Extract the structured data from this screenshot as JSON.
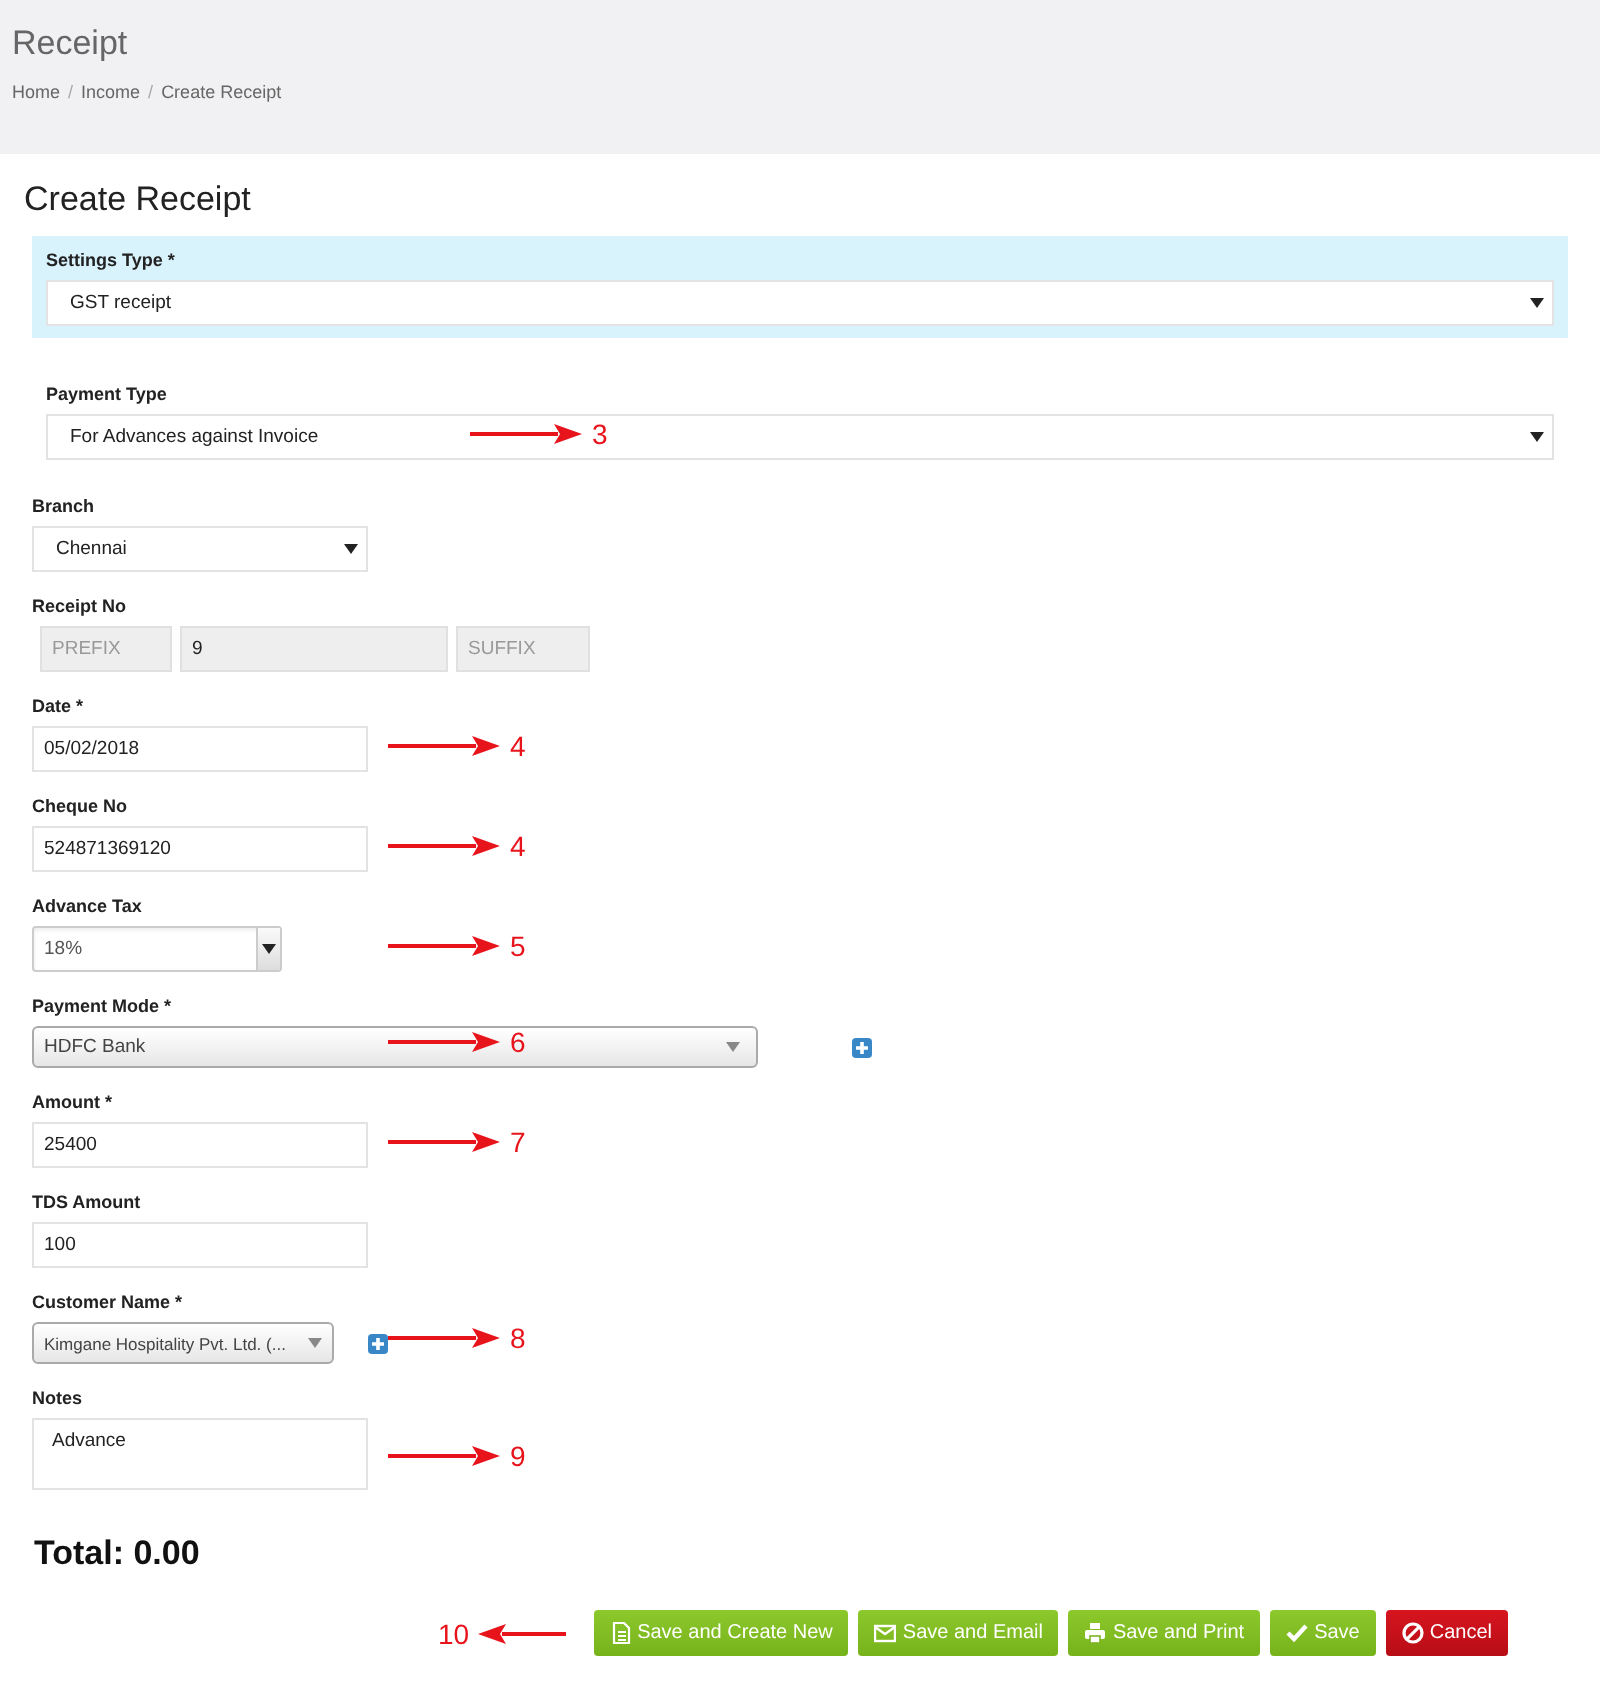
{
  "header": {
    "title": "Receipt",
    "breadcrumb": [
      {
        "label": "Home",
        "separator": "/"
      },
      {
        "label": "Income",
        "separator": "/"
      },
      {
        "label": "Create Receipt"
      }
    ]
  },
  "form": {
    "title": "Create Receipt",
    "fields": [
      {
        "kind": "wide-select",
        "label": "Settings Type *",
        "value": "GST receipt",
        "highlighted": true
      },
      {
        "kind": "wide-select",
        "label": "Payment Type",
        "value": "For Advances against Invoice",
        "highlighted": false,
        "annotation": "3"
      },
      {
        "kind": "select",
        "label": "Branch",
        "value": "Chennai"
      },
      {
        "kind": "group",
        "label": "Receipt No",
        "parts": [
          {
            "placeholder": "PREFIX"
          },
          {
            "value": "9"
          },
          {
            "placeholder": "SUFFIX"
          }
        ]
      },
      {
        "kind": "text",
        "label": "Date *",
        "value": "05/02/2018",
        "annotation": "4"
      },
      {
        "kind": "text",
        "label": "Cheque No",
        "value": "524871369120",
        "annotation": "4"
      },
      {
        "kind": "spin-select",
        "label": "Advance Tax",
        "value": "18%",
        "annotation": "5"
      },
      {
        "kind": "combo-wide",
        "label": "Payment Mode *",
        "value": "HDFC Bank",
        "add_button": true,
        "annotation": "6"
      },
      {
        "kind": "text",
        "label": "Amount *",
        "value": "25400",
        "annotation": "7"
      },
      {
        "kind": "text",
        "label": "TDS Amount",
        "value": "100"
      },
      {
        "kind": "combo",
        "label": "Customer Name *",
        "value": "Kimgane Hospitality Pvt. Ltd. (...",
        "add_button": true,
        "annotation": "8"
      },
      {
        "kind": "textarea",
        "label": "Notes",
        "value": "Advance",
        "annotation": "9"
      }
    ],
    "total": "Total: 0.00",
    "actions_annotation": "10",
    "buttons": [
      {
        "label": "Save and Create New",
        "kind": "success"
      },
      {
        "label": "Save and Email",
        "kind": "success"
      },
      {
        "label": "Save and Print",
        "kind": "success"
      },
      {
        "label": "Save",
        "kind": "success"
      },
      {
        "label": "Cancel",
        "kind": "danger"
      }
    ]
  }
}
